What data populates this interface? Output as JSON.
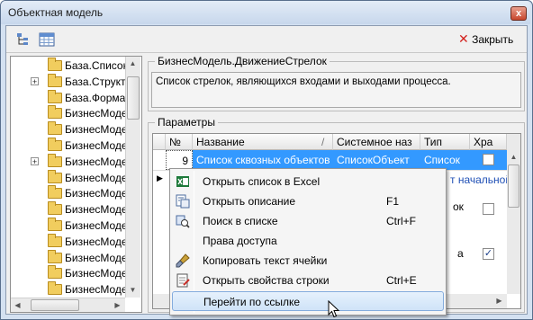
{
  "window": {
    "title": "Объектная модель",
    "close_glyph": "x"
  },
  "toolbar": {
    "close_label": "Закрыть",
    "icons": [
      "tree-structure-icon",
      "table-icon"
    ]
  },
  "tree": {
    "items": [
      {
        "label": "База.Список",
        "expandable": false
      },
      {
        "label": "База.Структу",
        "expandable": true
      },
      {
        "label": "База.Формат",
        "expandable": false
      },
      {
        "label": "БизнесМоде",
        "expandable": false
      },
      {
        "label": "БизнесМоде",
        "expandable": false
      },
      {
        "label": "БизнесМоде",
        "expandable": false
      },
      {
        "label": "БизнесМоде",
        "expandable": true
      },
      {
        "label": "БизнесМоде",
        "expandable": false
      },
      {
        "label": "БизнесМоде",
        "expandable": false
      },
      {
        "label": "БизнесМоде",
        "expandable": false
      },
      {
        "label": "БизнесМоде",
        "expandable": false
      },
      {
        "label": "БизнесМоде",
        "expandable": false
      },
      {
        "label": "БизнесМоде",
        "expandable": false
      },
      {
        "label": "БизнесМоде",
        "expandable": false
      },
      {
        "label": "БизнесМоде",
        "expandable": false
      }
    ]
  },
  "description": {
    "title": "БизнесМодель.ДвижениеСтрелок",
    "text": "Список стрелок, являющихся входами и выходами процесса."
  },
  "params": {
    "title": "Параметры",
    "columns": [
      "№",
      "Название",
      "Системное наз",
      "Тип",
      "Хра"
    ],
    "selected_row": {
      "num": "9",
      "name": "Список сквозных объектов",
      "sysname": "СписокОбъект",
      "type": "Список",
      "stored": false
    },
    "partial_texts": [
      "т начальной",
      "ок",
      "а"
    ]
  },
  "context_menu": {
    "items": [
      {
        "label": "Открыть список в Excel",
        "shortcut": "",
        "icon": "excel-icon"
      },
      {
        "label": "Открыть описание",
        "shortcut": "F1",
        "icon": "open-description-icon"
      },
      {
        "label": "Поиск в списке",
        "shortcut": "Ctrl+F",
        "icon": "search-list-icon"
      },
      {
        "label": "Права доступа",
        "shortcut": "",
        "icon": ""
      },
      {
        "label": "Копировать текст ячейки",
        "shortcut": "",
        "icon": "brush-icon"
      },
      {
        "label": "Открыть свойства строки",
        "shortcut": "Ctrl+E",
        "icon": "properties-icon"
      },
      {
        "label": "Перейти по ссылке",
        "shortcut": "",
        "icon": ""
      }
    ],
    "highlighted": "Перейти по ссылке"
  },
  "colors": {
    "selection": "#3399ff",
    "link_blue": "#1f4fb5",
    "close_red": "#d3231f"
  }
}
